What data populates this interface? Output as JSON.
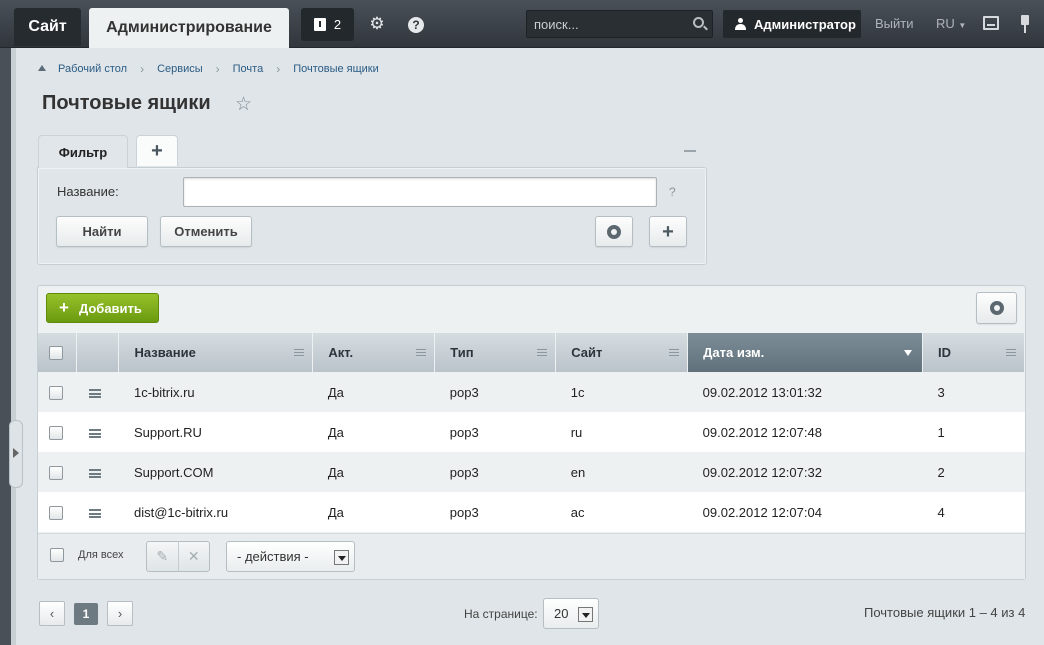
{
  "topbar": {
    "site_tab": "Сайт",
    "admin_tab": "Администрирование",
    "notifications_count": "2",
    "search_placeholder": "поиск...",
    "user_name": "Администратор",
    "logout": "Выйти",
    "language": "RU"
  },
  "breadcrumb": [
    "Рабочий стол",
    "Сервисы",
    "Почта",
    "Почтовые ящики"
  ],
  "page_title": "Почтовые ящики",
  "filter": {
    "tab_label": "Фильтр",
    "add_tab": "+",
    "name_label": "Название:",
    "name_value": "",
    "help": "?",
    "find_button": "Найти",
    "cancel_button": "Отменить"
  },
  "list": {
    "add_button": "Добавить",
    "columns": [
      "Название",
      "Акт.",
      "Тип",
      "Сайт",
      "Дата изм.",
      "ID"
    ],
    "sorted_column": "Дата изм.",
    "rows": [
      {
        "name": "1c-bitrix.ru",
        "active": "Да",
        "type": "pop3",
        "site": "1c",
        "date": "09.02.2012 13:01:32",
        "id": "3"
      },
      {
        "name": "Support.RU",
        "active": "Да",
        "type": "pop3",
        "site": "ru",
        "date": "09.02.2012 12:07:48",
        "id": "1"
      },
      {
        "name": "Support.COM",
        "active": "Да",
        "type": "pop3",
        "site": "en",
        "date": "09.02.2012 12:07:32",
        "id": "2"
      },
      {
        "name": "dist@1c-bitrix.ru",
        "active": "Да",
        "type": "pop3",
        "site": "ac",
        "date": "09.02.2012 12:07:04",
        "id": "4"
      }
    ],
    "for_all_label": "Для всех",
    "actions_select": "- действия -"
  },
  "pagination": {
    "prev": "‹",
    "current_page": "1",
    "next": "›",
    "per_page_label": "На странице:",
    "per_page_value": "20",
    "summary": "Почтовые ящики 1 – 4 из 4"
  },
  "colors": {
    "topbar": "#3a4046",
    "add_button": "#7fab1c",
    "sorted_header": "#6d7e89",
    "link": "#2b5c85"
  }
}
